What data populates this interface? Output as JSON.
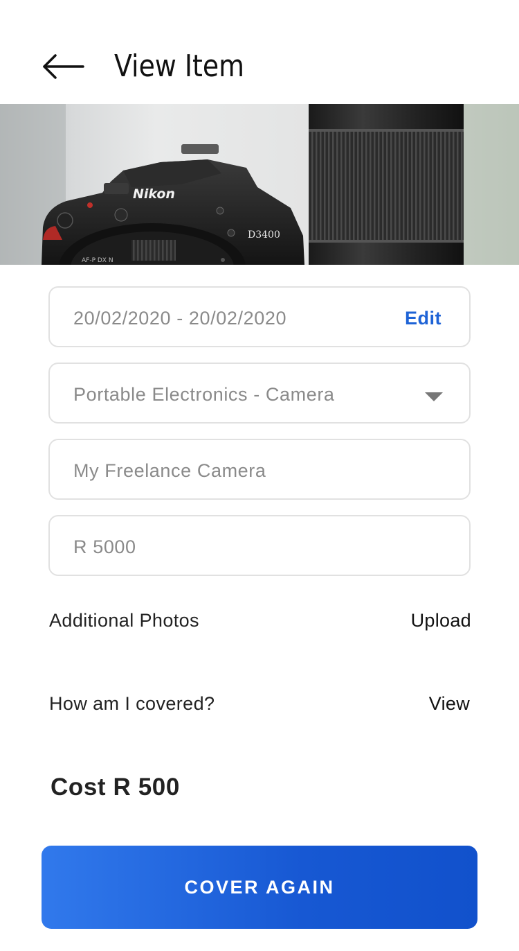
{
  "header": {
    "title": "View Item"
  },
  "hero": {
    "camera_brand": "Nikon",
    "camera_model": "D3400"
  },
  "form": {
    "date_range": "20/02/2020 - 20/02/2020",
    "edit_label": "Edit",
    "category": "Portable Electronics - Camera",
    "item_name": "My Freelance Camera",
    "item_value": "R 5000"
  },
  "rows": {
    "photos_label": "Additional Photos",
    "photos_action": "Upload",
    "coverage_label": "How am I covered?",
    "coverage_action": "View"
  },
  "cost": {
    "label": "Cost R 500"
  },
  "cta": {
    "label": "COVER AGAIN"
  },
  "colors": {
    "accent": "#1e63d6",
    "button_start": "#3179ec",
    "button_end": "#1151cc",
    "border": "#e1e1e1",
    "muted_text": "#8a8a8a"
  },
  "icons": {
    "back": "arrow-left-icon",
    "dropdown": "caret-down-icon"
  }
}
